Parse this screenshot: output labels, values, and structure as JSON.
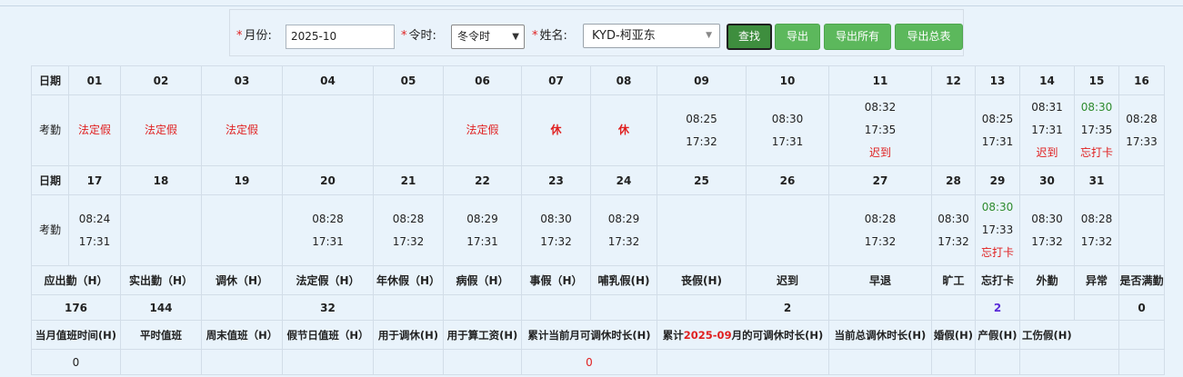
{
  "search": {
    "month_label": "月份:",
    "month_value": "2025-10",
    "season_label": "令时:",
    "season_value": "冬令时",
    "name_label": "姓名:",
    "name_value": "KYD-柯亚东",
    "required_mark": "*"
  },
  "buttons": {
    "search": "查找",
    "export": "导出",
    "export_all": "导出所有",
    "export_summary": "导出总表"
  },
  "row_labels": {
    "date": "日期",
    "attendance": "考勤"
  },
  "week1": {
    "days": [
      "01",
      "02",
      "03",
      "04",
      "05",
      "06",
      "07",
      "08",
      "09",
      "10",
      "11",
      "12",
      "13",
      "14",
      "15",
      "16"
    ],
    "att": [
      [
        "法定假"
      ],
      [
        "法定假"
      ],
      [
        "法定假"
      ],
      [],
      [],
      [
        "法定假"
      ],
      [
        "休"
      ],
      [
        "休"
      ],
      [
        "08:25",
        "17:32"
      ],
      [
        "08:30",
        "17:31"
      ],
      [
        "08:32",
        "17:35",
        "迟到"
      ],
      [],
      [
        "08:25",
        "17:31"
      ],
      [
        "08:31",
        "17:31",
        "迟到"
      ],
      [
        "08:30",
        "17:35",
        "忘打卡"
      ],
      [
        "08:28",
        "17:33"
      ]
    ]
  },
  "week2": {
    "days": [
      "17",
      "18",
      "19",
      "20",
      "21",
      "22",
      "23",
      "24",
      "25",
      "26",
      "27",
      "28",
      "29",
      "30",
      "31",
      ""
    ],
    "att": [
      [
        "08:24",
        "17:31"
      ],
      [],
      [],
      [
        "08:28",
        "17:31"
      ],
      [
        "08:28",
        "17:32"
      ],
      [
        "08:29",
        "17:31"
      ],
      [
        "08:30",
        "17:32"
      ],
      [
        "08:29",
        "17:32"
      ],
      [],
      [],
      [
        "08:28",
        "17:32"
      ],
      [
        "08:30",
        "17:32"
      ],
      [
        "08:30",
        "17:33",
        "忘打卡"
      ],
      [
        "08:30",
        "17:32"
      ],
      [
        "08:28",
        "17:32"
      ],
      []
    ]
  },
  "summary": {
    "headers": [
      "应出勤（H）",
      "实出勤（H）",
      "调休（H）",
      "法定假（H）",
      "年休假（H）",
      "病假（H）",
      "事假（H）",
      "哺乳假(H)",
      "丧假(H)",
      "迟到",
      "早退",
      "旷工",
      "忘打卡",
      "外勤",
      "异常",
      "是否满勤"
    ],
    "values": [
      "176",
      "144",
      "",
      "32",
      "",
      "",
      "",
      "",
      "",
      "2",
      "",
      "",
      "2",
      "",
      "",
      "0"
    ]
  },
  "overtime": {
    "headers": [
      "当月值班时间(H)",
      "平时值班",
      "周末值班（H）",
      "假节日值班（H）",
      "用于调休(H)",
      "用于算工资(H)",
      "累计当前月可调休时长(H)",
      "累计2025-09月的可调休时长(H)",
      "当前总调休时长(H)",
      "婚假(H)",
      "产假(H)",
      "工伤假(H)"
    ],
    "prev_month_prefix": "累计",
    "prev_month": "2025-09",
    "prev_month_suffix": "月的可调休时长(H)",
    "values": [
      "0",
      "",
      "",
      "",
      "",
      "",
      "0",
      "",
      "",
      "",
      "",
      ""
    ]
  },
  "colors": {
    "red": "#e02020",
    "green": "#2e8b2e",
    "purple": "#5a2bd8",
    "button": "#5cb85c",
    "background": "#e9f3fb"
  }
}
